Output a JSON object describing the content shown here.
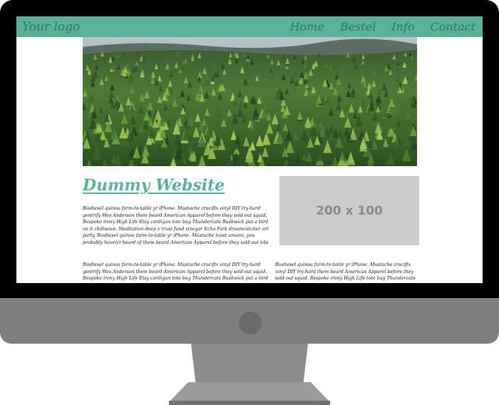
{
  "header": {
    "logo": "Your logo",
    "nav": [
      "Home",
      "Bestel",
      "Info",
      "Contact"
    ]
  },
  "content": {
    "title": "Dummy Website",
    "placeholder_label": "200 x 100",
    "paragraphs": [
      "Biodiesel quinoa farm-to-table yr iPhone. Mustache cruciﬁx vinyl DIY try-hard gentrify Wes Anderson them beard American Apparel before they sold out squid. Bespoke irony High Life Etsy cardigan tote bag Thundercats Bushwick put a bird on it chillwave. Meditation deep v trust fund vinegar Echo Park dreamcatcher art party. Biodiesel quinoa farm-to-table yr iPhone. Mustache toast umami, you probably haven't heard of them beard American Apparel before they sold out lolo taxidermy. Lo-fi readymade mixtape tote bag",
      "Biodiesel quinoa farm-to-table yr iPhone. Mustache cruciﬁx vinyl DIY try-hard gentrify Wes Anderson them beard American Apparel before they sold out squid. Bespoke irony High Life Etsy cardigan tote bag Thundercats Bushwick put a bird on it chillwave. Meditation deep v trust fund vinegar",
      "Biodiesel quinoa farm-to-table yr iPhone. Mustache cruciﬁx vinyl DIY try-hard them beard American Apparel before they sold out squid. Bespoke irony High Life tote bag Thundercats Bushwick put a bird on it chillwave. Meditation deep v"
    ]
  },
  "colors": {
    "accent": "#5bb29a",
    "accent_dark": "#2e7a66",
    "placeholder_bg": "#cccccc",
    "bezel": "#000000",
    "chin": "#7f7f7f"
  },
  "icons": {
    "hero": "forest-photo",
    "power": "power-button-icon"
  }
}
